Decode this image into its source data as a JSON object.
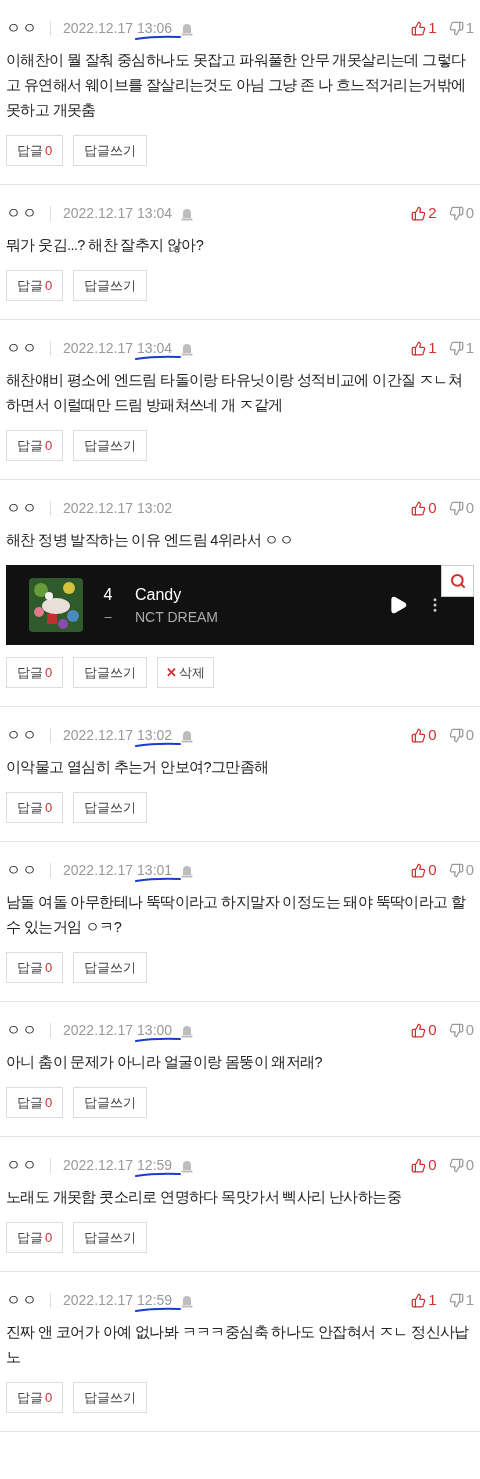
{
  "comments": [
    {
      "author": "ㅇㅇ",
      "date": "2022.12.17",
      "time": "13:06",
      "underlined": true,
      "report_icon": true,
      "likes": "1",
      "dislikes": "1",
      "text": "이해찬이 뭘 잘춰 중심하나도 못잡고 파워풀한 안무 개못살리는데 그렇다고 유연해서 웨이브를 잘살리는것도 아님 그냥 존 나 흐느적거리는거밖에 못하고 개못춤",
      "reply_label": "답글",
      "reply_count": "0",
      "write_label": "답글쓰기"
    },
    {
      "author": "ㅇㅇ",
      "date": "2022.12.17",
      "time": "13:04",
      "underlined": false,
      "report_icon": true,
      "likes": "2",
      "dislikes": "0",
      "text": "뭐가 웃김...? 해찬 잘추지 않아?",
      "reply_label": "답글",
      "reply_count": "0",
      "write_label": "답글쓰기"
    },
    {
      "author": "ㅇㅇ",
      "date": "2022.12.17",
      "time": "13:04",
      "underlined": true,
      "report_icon": true,
      "likes": "1",
      "dislikes": "1",
      "text": "해찬얘비 평소에 엔드림 타돌이랑 타유닛이랑 성적비교에 이간질 ㅈㄴ쳐하면서 이럴때만 드림 방패쳐쓰네 개 ㅈ같게",
      "reply_label": "답글",
      "reply_count": "0",
      "write_label": "답글쓰기"
    },
    {
      "author": "ㅇㅇ",
      "date": "2022.12.17",
      "time": "13:02",
      "underlined": false,
      "report_icon": false,
      "likes": "0",
      "dislikes": "0",
      "text": "해찬 정병 발작하는 이유 엔드림 4위라서 ㅇㅇ",
      "music": {
        "rank": "4",
        "change": "–",
        "title": "Candy",
        "artist": "NCT DREAM"
      },
      "reply_label": "답글",
      "reply_count": "0",
      "write_label": "답글쓰기",
      "delete_icon": "✕",
      "delete_label": "삭제"
    },
    {
      "author": "ㅇㅇ",
      "date": "2022.12.17",
      "time": "13:02",
      "underlined": true,
      "report_icon": true,
      "likes": "0",
      "dislikes": "0",
      "text": "이악물고 열심히 추는거 안보여?그만좀해",
      "reply_label": "답글",
      "reply_count": "0",
      "write_label": "답글쓰기"
    },
    {
      "author": "ㅇㅇ",
      "date": "2022.12.17",
      "time": "13:01",
      "underlined": true,
      "report_icon": true,
      "likes": "0",
      "dislikes": "0",
      "text": "남돌 여돌 아무한테나 뚝딱이라고 하지말자 이정도는 돼야 뚝딱이라고 할수 있는거임 ㅇㅋ?",
      "reply_label": "답글",
      "reply_count": "0",
      "write_label": "답글쓰기"
    },
    {
      "author": "ㅇㅇ",
      "date": "2022.12.17",
      "time": "13:00",
      "underlined": true,
      "report_icon": true,
      "likes": "0",
      "dislikes": "0",
      "text": "아니 춤이 문제가 아니라 얼굴이랑 몸뚱이 왜저래?",
      "reply_label": "답글",
      "reply_count": "0",
      "write_label": "답글쓰기"
    },
    {
      "author": "ㅇㅇ",
      "date": "2022.12.17",
      "time": "12:59",
      "underlined": true,
      "report_icon": true,
      "likes": "0",
      "dislikes": "0",
      "text": "노래도 개못함 콧소리로 연명하다 목맛가서 삑사리 난사하는중",
      "reply_label": "답글",
      "reply_count": "0",
      "write_label": "답글쓰기"
    },
    {
      "author": "ㅇㅇ",
      "date": "2022.12.17",
      "time": "12:59",
      "underlined": true,
      "report_icon": true,
      "likes": "1",
      "dislikes": "1",
      "text": "진짜 앤 코어가 아예 없나봐 ㅋㅋㅋ중심축 하나도 안잡혀서 ㅈㄴ 정신사납노",
      "reply_label": "답글",
      "reply_count": "0",
      "write_label": "답글쓰기"
    }
  ]
}
